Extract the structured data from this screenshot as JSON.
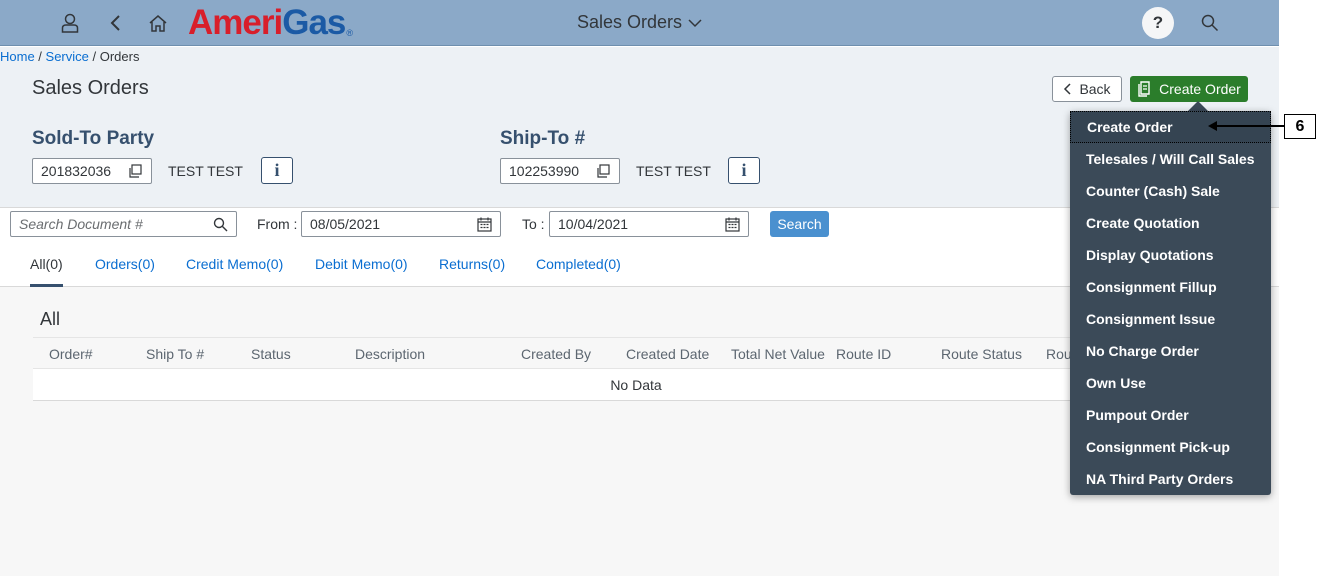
{
  "shell": {
    "logo_red": "Ameri",
    "logo_blue": "Gas",
    "logo_reg": "®",
    "title": "Sales Orders",
    "help_label": "?"
  },
  "breadcrumb": {
    "home": "Home",
    "sep1": " / ",
    "service": "Service",
    "sep2": " / ",
    "current": "Orders"
  },
  "page": {
    "title": "Sales Orders",
    "back_label": "Back",
    "create_label": "Create Order"
  },
  "sold_to": {
    "label": "Sold-To Party",
    "number": "201832036",
    "name": "TEST TEST"
  },
  "ship_to": {
    "label": "Ship-To #",
    "number": "102253990",
    "name": "TEST TEST"
  },
  "info_label": "i",
  "filters": {
    "search_placeholder": "Search Document #",
    "from_label": "From :",
    "from_value": "08/05/2021",
    "to_label": "To :",
    "to_value": "10/04/2021",
    "search_label": "Search"
  },
  "tabs": [
    {
      "label": "All(0)"
    },
    {
      "label": "Orders(0)"
    },
    {
      "label": "Credit Memo(0)"
    },
    {
      "label": "Debit Memo(0)"
    },
    {
      "label": "Returns(0)"
    },
    {
      "label": "Completed(0)"
    }
  ],
  "table": {
    "section_title": "All",
    "columns": [
      "Order#",
      "Ship To #",
      "Status",
      "Description",
      "Created By",
      "Created Date",
      "Total Net Value",
      "Route ID",
      "Route Status",
      "Rou"
    ],
    "no_data": "No Data"
  },
  "menu": {
    "items": [
      "Create Order",
      "Telesales / Will Call Sales",
      "Counter (Cash) Sale",
      "Create Quotation",
      "Display Quotations",
      "Consignment Fillup",
      "Consignment Issue",
      "No Charge Order",
      "Own Use",
      "Pumpout Order",
      "Consignment Pick-up",
      "NA Third Party Orders"
    ]
  },
  "annotation": {
    "label": "6"
  },
  "colors": {
    "shell": "#8ba9c8",
    "primary_button": "#2b7d2b",
    "menu_bg": "#3b4a58",
    "link": "#0a6ed1"
  }
}
